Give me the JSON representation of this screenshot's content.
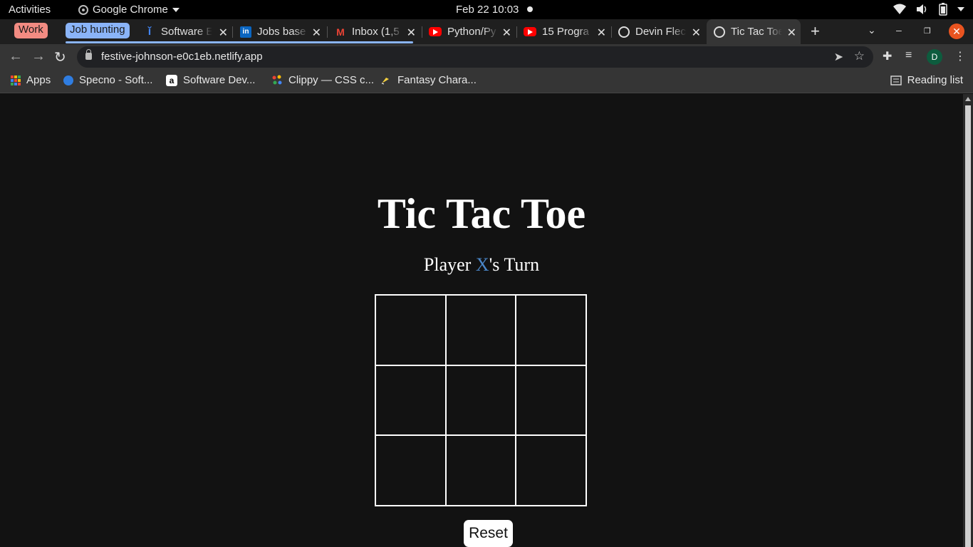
{
  "system_bar": {
    "activities": "Activities",
    "app_name": "Google Chrome",
    "clock": "Feb 22  10:03"
  },
  "tab_groups": {
    "work": "Work",
    "job_hunting": "Job hunting"
  },
  "tabs": [
    {
      "title": "Software E",
      "icon": "info-icon"
    },
    {
      "title": "Jobs base",
      "icon": "linkedin-icon"
    },
    {
      "title": "Inbox (1,5",
      "icon": "gmail-icon"
    },
    {
      "title": "Python/Py",
      "icon": "youtube-icon"
    },
    {
      "title": "15 Progra",
      "icon": "youtube-icon"
    },
    {
      "title": "Devin Flec",
      "icon": "globe-icon"
    },
    {
      "title": "Tic Tac Toe",
      "icon": "globe-icon",
      "active": true
    }
  ],
  "address_bar": {
    "url": "festive-johnson-e0c1eb.netlify.app"
  },
  "profile": {
    "initial": "D",
    "color": "#0d5c3e"
  },
  "bookmarks": [
    {
      "label": "Apps",
      "icon": "apps-grid-icon"
    },
    {
      "label": "Specno - Soft...",
      "icon": "specno-icon"
    },
    {
      "label": "Software Dev...",
      "icon": "amazon-icon"
    },
    {
      "label": "Clippy — CSS c...",
      "icon": "clippy-icon"
    },
    {
      "label": "Fantasy Chara...",
      "icon": "fantasy-icon"
    }
  ],
  "reading_list": "Reading list",
  "game": {
    "title": "Tic Tac Toe",
    "turn_prefix": "Player ",
    "current_player": "X",
    "turn_suffix": "'s Turn",
    "player_color": "#4a86c8",
    "board": [
      "",
      "",
      "",
      "",
      "",
      "",
      "",
      "",
      ""
    ],
    "reset_label": "Reset"
  }
}
